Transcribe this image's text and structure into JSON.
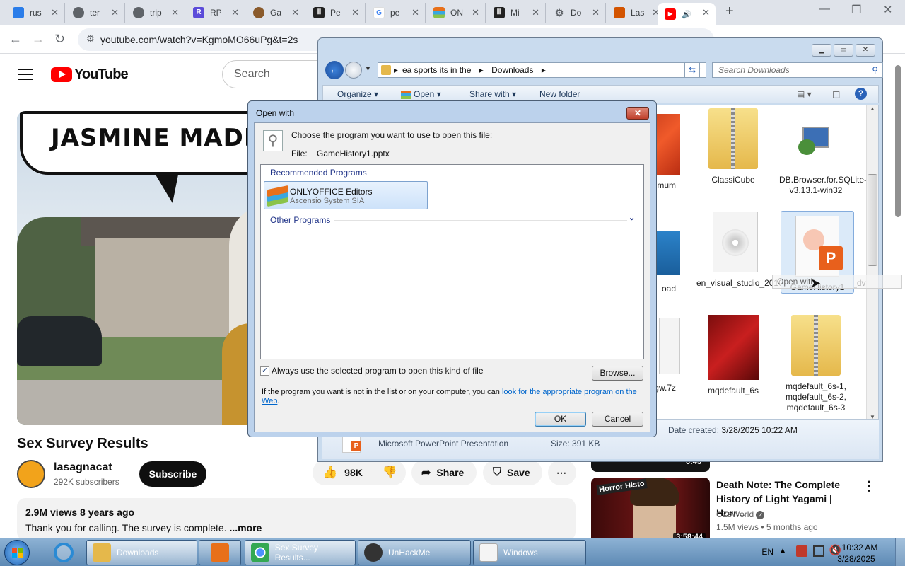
{
  "browser": {
    "tabs": [
      {
        "label": "rus",
        "icon": "globe-icon",
        "color": "#2b7de9"
      },
      {
        "label": "ter",
        "icon": "globe-icon",
        "color": "#5f6368"
      },
      {
        "label": "trip",
        "icon": "globe-icon",
        "color": "#5f6368"
      },
      {
        "label": "RP",
        "icon": "rp-icon",
        "color": "#5b4bd9"
      },
      {
        "label": "Ga",
        "icon": "avatar-icon",
        "color": "#8a5a2b"
      },
      {
        "label": "Pe",
        "icon": "museum-icon",
        "color": "#222222"
      },
      {
        "label": "pe",
        "icon": "google-icon",
        "color": "#4285f4"
      },
      {
        "label": "ON",
        "icon": "onlyoffice-icon",
        "color": "#e8701a"
      },
      {
        "label": "Mi",
        "icon": "museum-icon",
        "color": "#222222"
      },
      {
        "label": "Do",
        "icon": "gear-icon",
        "color": "#5f6368"
      },
      {
        "label": "Las",
        "icon": "lasagnacat-icon",
        "color": "#d35400"
      },
      {
        "label": "",
        "icon": "youtube-icon",
        "color": "#ff0000"
      }
    ],
    "url": "youtube.com/watch?v=KgmoMO66uPg&t=2s"
  },
  "youtube": {
    "logo_text": "YouTube",
    "search_placeholder": "Search",
    "video_caption": "JASMINE MADRI",
    "video_title": "Sex Survey Results",
    "channel_name": "lasagnacat",
    "subscribers": "292K subscribers",
    "subscribe_label": "Subscribe",
    "likes": "98K",
    "share_label": "Share",
    "save_label": "Save",
    "views_date": "2.9M views  8 years ago",
    "description": "Thank you for calling. The survey is complete. ",
    "more_label": "...more",
    "rec1_duration": "0:43",
    "rec2": {
      "title": "Death Note: The Complete History of Light Yagami | Horr...",
      "channel": "CZsWorld",
      "meta": "1.5M views • 5 months ago",
      "duration": "3:58:44",
      "thumb_label": "Horror Histo"
    }
  },
  "explorer": {
    "breadcrumb_1": "ea sports its in the",
    "breadcrumb_2": "Downloads",
    "search_placeholder": "Search Downloads",
    "commands": {
      "organize": "Organize",
      "open": "Open",
      "share": "Share with",
      "newfolder": "New folder"
    },
    "files": [
      {
        "name": "emum"
      },
      {
        "name": "ClassiCube"
      },
      {
        "name": "DB.Browser.for.SQLite-v3.13.1-win32"
      },
      {
        "name": "oad"
      },
      {
        "name": "en_visual_studio_2010_professional_x86_dvd_509727"
      },
      {
        "name": "GameHistory1"
      },
      {
        "name": "5.0.1-regw.7z"
      },
      {
        "name": "mqdefault_6s"
      },
      {
        "name": "mqdefault_6s-1, mqdefault_6s-2, mqdefault_6s-3"
      }
    ],
    "details": {
      "type": "Microsoft PowerPoint Presentation",
      "size_label": "Size:",
      "size": "391 KB",
      "date_label": "Date created:",
      "date": "3/28/2025 10:22 AM"
    },
    "tooltip": "Open with"
  },
  "dialog": {
    "title": "Open with",
    "choose_text": "Choose the program you want to use to open this file:",
    "file_label": "File:",
    "file_name": "GameHistory1.pptx",
    "recommended": "Recommended Programs",
    "app_name": "ONLYOFFICE Editors",
    "app_publisher": "Ascensio System SIA",
    "other": "Other Programs",
    "always_use": "Always use the selected program to open this kind of file",
    "browse": "Browse...",
    "hint": "If the program you want is not in the list or on your computer, you can ",
    "hint_link": "look for the appropriate program on the Web",
    "hint_end": ".",
    "ok": "OK",
    "cancel": "Cancel"
  },
  "taskbar": {
    "tasks": [
      {
        "label": "Downloads"
      },
      {
        "label": "Sex Survey Results..."
      },
      {
        "label": "UnHackMe"
      },
      {
        "label": "Windows"
      }
    ],
    "lang": "EN",
    "time": "10:32 AM",
    "date": "3/28/2025"
  }
}
